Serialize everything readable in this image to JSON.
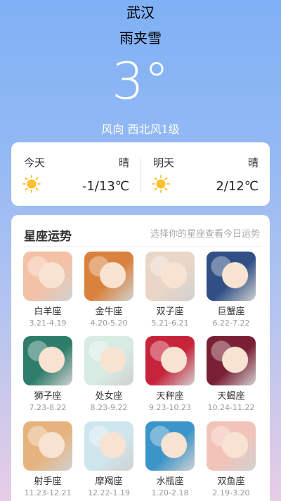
{
  "weather": {
    "city": "武汉",
    "condition": "雨夹雪",
    "temperature": "3°",
    "wind": "风向 西北风1级"
  },
  "forecast": [
    {
      "day": "今天",
      "weather": "晴",
      "temp": "-1/13℃",
      "icon": "sun-icon"
    },
    {
      "day": "明天",
      "weather": "晴",
      "temp": "2/12℃",
      "icon": "sun-icon"
    }
  ],
  "zodiac": {
    "title": "星座运势",
    "hint": "选择你的星座查看今日运势",
    "items": [
      {
        "name": "白羊座",
        "dates": "3.21-4.19",
        "color": "#f3c1a6"
      },
      {
        "name": "金牛座",
        "dates": "4.20-5.20",
        "color": "#d9823e"
      },
      {
        "name": "双子座",
        "dates": "5.21-6.21",
        "color": "#e9d6c6"
      },
      {
        "name": "巨蟹座",
        "dates": "6.22-7.22",
        "color": "#2f4f85"
      },
      {
        "name": "狮子座",
        "dates": "7.23-8.22",
        "color": "#2e7d6a"
      },
      {
        "name": "处女座",
        "dates": "8.23-9.22",
        "color": "#d6ece3"
      },
      {
        "name": "天秤座",
        "dates": "9.23-10.23",
        "color": "#c7233a"
      },
      {
        "name": "天蝎座",
        "dates": "10.24-11.22",
        "color": "#7a2035"
      },
      {
        "name": "射手座",
        "dates": "11.23-12.21",
        "color": "#e6b37e"
      },
      {
        "name": "摩羯座",
        "dates": "12.22-1.19",
        "color": "#cfe6ef"
      },
      {
        "name": "水瓶座",
        "dates": "1.20-2.18",
        "color": "#3b95c8"
      },
      {
        "name": "双鱼座",
        "dates": "2.19-3.20",
        "color": "#f2c3b8"
      }
    ]
  }
}
